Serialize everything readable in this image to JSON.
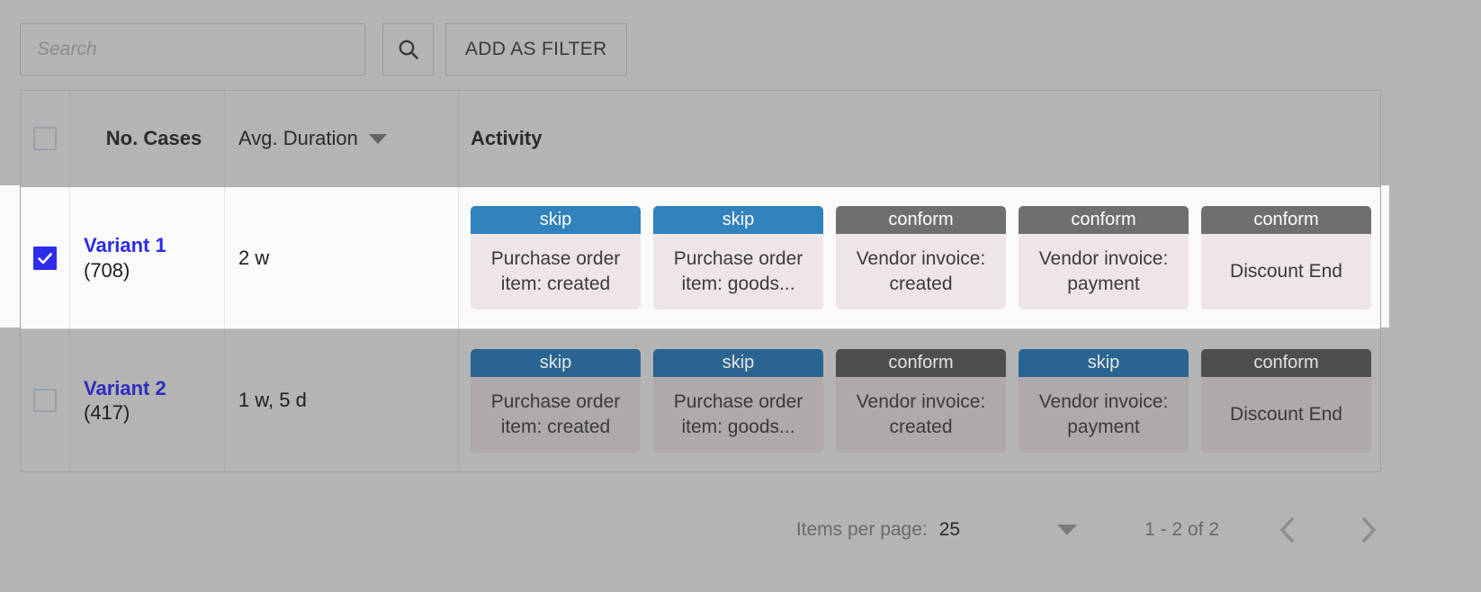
{
  "toolbar": {
    "search_placeholder": "Search",
    "search_value": "",
    "search_icon": "search-icon",
    "add_filter_label": "ADD AS FILTER"
  },
  "table": {
    "headers": {
      "select_all": "",
      "no_cases": "No. Cases",
      "avg_duration": "Avg. Duration",
      "activity": "Activity",
      "sort_icon": "sort-descending-caret-icon"
    },
    "rows": [
      {
        "selected": true,
        "variant": "Variant 1",
        "count": "(708)",
        "duration": "2 w",
        "activities": [
          {
            "status": "skip",
            "name": "Purchase order item: created"
          },
          {
            "status": "skip",
            "name": "Purchase order item: goods..."
          },
          {
            "status": "conform",
            "name": "Vendor invoice: created"
          },
          {
            "status": "conform",
            "name": "Vendor invoice: payment"
          },
          {
            "status": "conform",
            "name": "Discount End"
          }
        ]
      },
      {
        "selected": false,
        "variant": "Variant 2",
        "count": "(417)",
        "duration": "1 w, 5 d",
        "activities": [
          {
            "status": "skip",
            "name": "Purchase order item: created"
          },
          {
            "status": "skip",
            "name": "Purchase order item: goods..."
          },
          {
            "status": "conform",
            "name": "Vendor invoice: created"
          },
          {
            "status": "skip",
            "name": "Vendor invoice: payment"
          },
          {
            "status": "conform",
            "name": "Discount End"
          }
        ]
      }
    ]
  },
  "paginator": {
    "items_per_page_label": "Items per page:",
    "items_per_page_value": "25",
    "range_label": "1 - 2 of 2",
    "prev_icon": "chevron-left-icon",
    "next_icon": "chevron-right-icon"
  },
  "colors": {
    "page_background": "#b4b4b4",
    "skip_accent": "#3182bd",
    "conform_accent": "#6f6f6f",
    "chip_body": "#eee6e6",
    "link_blue": "#2b2beb",
    "checkbox_checked": "#2d2ded"
  }
}
